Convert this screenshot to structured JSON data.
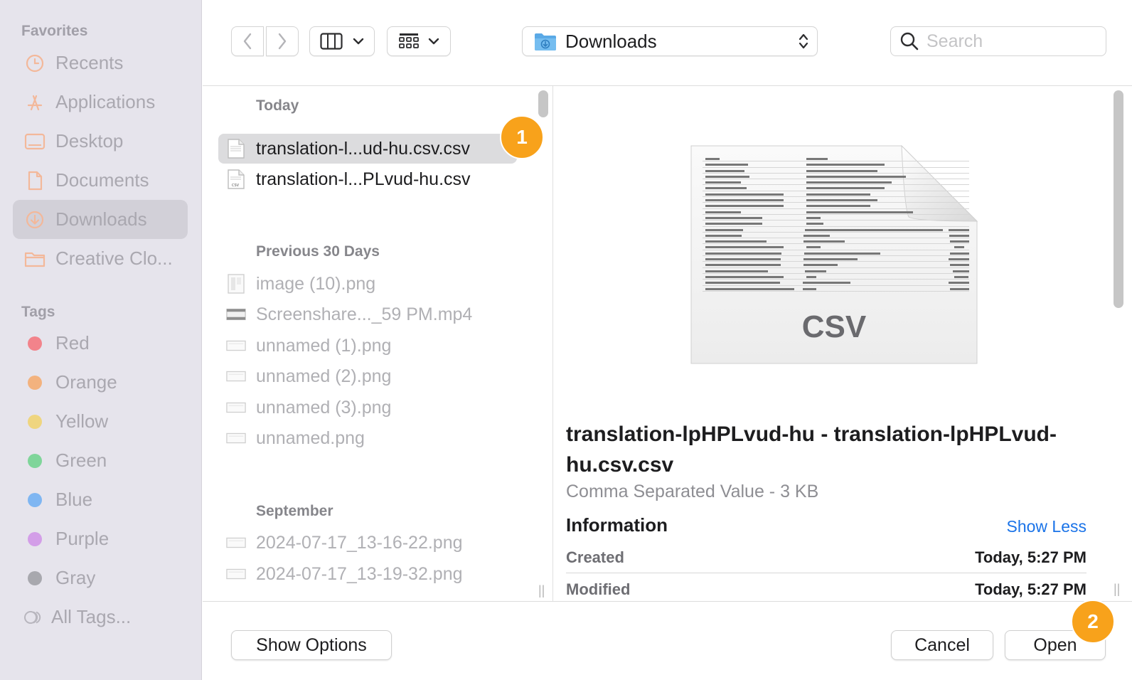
{
  "sidebar": {
    "favorites_heading": "Favorites",
    "favorites": [
      {
        "label": "Recents",
        "icon": "clock-icon"
      },
      {
        "label": "Applications",
        "icon": "applications-icon"
      },
      {
        "label": "Desktop",
        "icon": "desktop-icon"
      },
      {
        "label": "Documents",
        "icon": "document-icon"
      },
      {
        "label": "Downloads",
        "icon": "download-icon",
        "selected": true
      },
      {
        "label": "Creative Clo...",
        "icon": "folder-icon"
      }
    ],
    "tags_heading": "Tags",
    "tags": [
      {
        "label": "Red",
        "color": "#f2838b"
      },
      {
        "label": "Orange",
        "color": "#f3b27e"
      },
      {
        "label": "Yellow",
        "color": "#efd57f"
      },
      {
        "label": "Green",
        "color": "#7fd59a"
      },
      {
        "label": "Blue",
        "color": "#7fb6f2"
      },
      {
        "label": "Purple",
        "color": "#d39ee8"
      },
      {
        "label": "Gray",
        "color": "#a8a8ae"
      },
      {
        "label": "All Tags...",
        "color": null
      }
    ]
  },
  "toolbar": {
    "path_label": "Downloads",
    "search_placeholder": "Search"
  },
  "file_list": {
    "sections": [
      {
        "title": "Today",
        "files": [
          {
            "name": "translation-l...ud-hu.csv.csv",
            "selected": true,
            "dim": false
          },
          {
            "name": "translation-l...PLvud-hu.csv",
            "selected": false,
            "dim": false
          }
        ]
      },
      {
        "title": "Previous 30 Days",
        "files": [
          {
            "name": "image (10).png",
            "dim": true
          },
          {
            "name": "Screenshare..._59 PM.mp4",
            "dim": true
          },
          {
            "name": "unnamed (1).png",
            "dim": true
          },
          {
            "name": "unnamed (2).png",
            "dim": true
          },
          {
            "name": "unnamed (3).png",
            "dim": true
          },
          {
            "name": "unnamed.png",
            "dim": true
          }
        ]
      },
      {
        "title": "September",
        "files": [
          {
            "name": "2024-07-17_13-16-22.png",
            "dim": true
          },
          {
            "name": "2024-07-17_13-19-32.png",
            "dim": true
          }
        ]
      }
    ]
  },
  "preview": {
    "thumbnail_label": "CSV",
    "title": "translation-lpHPLvud-hu - translation-lpHPLvud-hu.csv.csv",
    "subtitle": "Comma Separated Value - 3 KB",
    "info_heading": "Information",
    "show_less": "Show Less",
    "rows": [
      {
        "key": "Created",
        "value": "Today, 5:27 PM"
      },
      {
        "key": "Modified",
        "value": "Today, 5:27 PM"
      }
    ]
  },
  "footer": {
    "show_options": "Show Options",
    "cancel": "Cancel",
    "open": "Open"
  },
  "badges": [
    "1",
    "2"
  ],
  "colors": {
    "accent_badge": "#f8a21b",
    "link": "#1a73e8",
    "folder_blue": "#5aa9e6"
  }
}
